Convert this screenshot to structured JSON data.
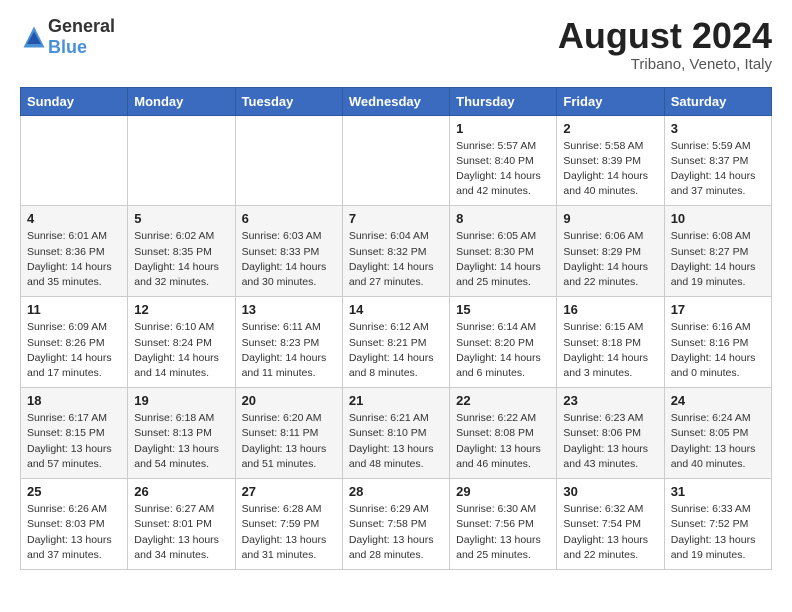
{
  "header": {
    "logo_general": "General",
    "logo_blue": "Blue",
    "month_year": "August 2024",
    "location": "Tribano, Veneto, Italy"
  },
  "weekdays": [
    "Sunday",
    "Monday",
    "Tuesday",
    "Wednesday",
    "Thursday",
    "Friday",
    "Saturday"
  ],
  "weeks": [
    [
      {
        "day": "",
        "info": ""
      },
      {
        "day": "",
        "info": ""
      },
      {
        "day": "",
        "info": ""
      },
      {
        "day": "",
        "info": ""
      },
      {
        "day": "1",
        "info": "Sunrise: 5:57 AM\nSunset: 8:40 PM\nDaylight: 14 hours\nand 42 minutes."
      },
      {
        "day": "2",
        "info": "Sunrise: 5:58 AM\nSunset: 8:39 PM\nDaylight: 14 hours\nand 40 minutes."
      },
      {
        "day": "3",
        "info": "Sunrise: 5:59 AM\nSunset: 8:37 PM\nDaylight: 14 hours\nand 37 minutes."
      }
    ],
    [
      {
        "day": "4",
        "info": "Sunrise: 6:01 AM\nSunset: 8:36 PM\nDaylight: 14 hours\nand 35 minutes."
      },
      {
        "day": "5",
        "info": "Sunrise: 6:02 AM\nSunset: 8:35 PM\nDaylight: 14 hours\nand 32 minutes."
      },
      {
        "day": "6",
        "info": "Sunrise: 6:03 AM\nSunset: 8:33 PM\nDaylight: 14 hours\nand 30 minutes."
      },
      {
        "day": "7",
        "info": "Sunrise: 6:04 AM\nSunset: 8:32 PM\nDaylight: 14 hours\nand 27 minutes."
      },
      {
        "day": "8",
        "info": "Sunrise: 6:05 AM\nSunset: 8:30 PM\nDaylight: 14 hours\nand 25 minutes."
      },
      {
        "day": "9",
        "info": "Sunrise: 6:06 AM\nSunset: 8:29 PM\nDaylight: 14 hours\nand 22 minutes."
      },
      {
        "day": "10",
        "info": "Sunrise: 6:08 AM\nSunset: 8:27 PM\nDaylight: 14 hours\nand 19 minutes."
      }
    ],
    [
      {
        "day": "11",
        "info": "Sunrise: 6:09 AM\nSunset: 8:26 PM\nDaylight: 14 hours\nand 17 minutes."
      },
      {
        "day": "12",
        "info": "Sunrise: 6:10 AM\nSunset: 8:24 PM\nDaylight: 14 hours\nand 14 minutes."
      },
      {
        "day": "13",
        "info": "Sunrise: 6:11 AM\nSunset: 8:23 PM\nDaylight: 14 hours\nand 11 minutes."
      },
      {
        "day": "14",
        "info": "Sunrise: 6:12 AM\nSunset: 8:21 PM\nDaylight: 14 hours\nand 8 minutes."
      },
      {
        "day": "15",
        "info": "Sunrise: 6:14 AM\nSunset: 8:20 PM\nDaylight: 14 hours\nand 6 minutes."
      },
      {
        "day": "16",
        "info": "Sunrise: 6:15 AM\nSunset: 8:18 PM\nDaylight: 14 hours\nand 3 minutes."
      },
      {
        "day": "17",
        "info": "Sunrise: 6:16 AM\nSunset: 8:16 PM\nDaylight: 14 hours\nand 0 minutes."
      }
    ],
    [
      {
        "day": "18",
        "info": "Sunrise: 6:17 AM\nSunset: 8:15 PM\nDaylight: 13 hours\nand 57 minutes."
      },
      {
        "day": "19",
        "info": "Sunrise: 6:18 AM\nSunset: 8:13 PM\nDaylight: 13 hours\nand 54 minutes."
      },
      {
        "day": "20",
        "info": "Sunrise: 6:20 AM\nSunset: 8:11 PM\nDaylight: 13 hours\nand 51 minutes."
      },
      {
        "day": "21",
        "info": "Sunrise: 6:21 AM\nSunset: 8:10 PM\nDaylight: 13 hours\nand 48 minutes."
      },
      {
        "day": "22",
        "info": "Sunrise: 6:22 AM\nSunset: 8:08 PM\nDaylight: 13 hours\nand 46 minutes."
      },
      {
        "day": "23",
        "info": "Sunrise: 6:23 AM\nSunset: 8:06 PM\nDaylight: 13 hours\nand 43 minutes."
      },
      {
        "day": "24",
        "info": "Sunrise: 6:24 AM\nSunset: 8:05 PM\nDaylight: 13 hours\nand 40 minutes."
      }
    ],
    [
      {
        "day": "25",
        "info": "Sunrise: 6:26 AM\nSunset: 8:03 PM\nDaylight: 13 hours\nand 37 minutes."
      },
      {
        "day": "26",
        "info": "Sunrise: 6:27 AM\nSunset: 8:01 PM\nDaylight: 13 hours\nand 34 minutes."
      },
      {
        "day": "27",
        "info": "Sunrise: 6:28 AM\nSunset: 7:59 PM\nDaylight: 13 hours\nand 31 minutes."
      },
      {
        "day": "28",
        "info": "Sunrise: 6:29 AM\nSunset: 7:58 PM\nDaylight: 13 hours\nand 28 minutes."
      },
      {
        "day": "29",
        "info": "Sunrise: 6:30 AM\nSunset: 7:56 PM\nDaylight: 13 hours\nand 25 minutes."
      },
      {
        "day": "30",
        "info": "Sunrise: 6:32 AM\nSunset: 7:54 PM\nDaylight: 13 hours\nand 22 minutes."
      },
      {
        "day": "31",
        "info": "Sunrise: 6:33 AM\nSunset: 7:52 PM\nDaylight: 13 hours\nand 19 minutes."
      }
    ]
  ]
}
